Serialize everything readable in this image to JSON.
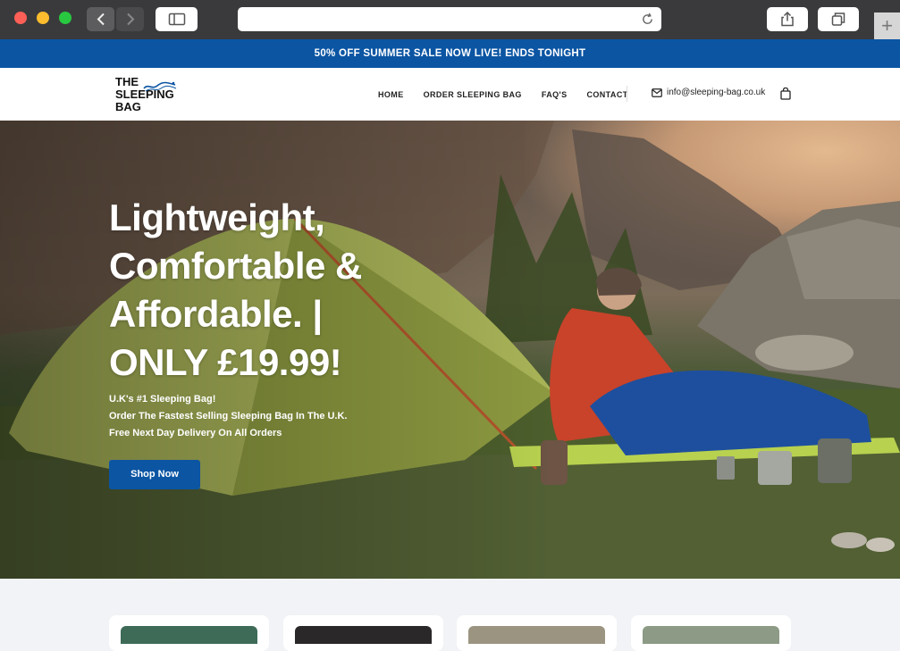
{
  "browser": {
    "back_icon": "chevron-left-icon",
    "forward_icon": "chevron-right-icon",
    "sidebar_icon": "sidebar-icon",
    "reload_icon": "reload-icon",
    "share_icon": "share-icon",
    "tabs_icon": "tabs-icon",
    "new_tab_icon": "plus-icon"
  },
  "announcement": {
    "text": "50% OFF SUMMER SALE NOW LIVE! ENDS TONIGHT"
  },
  "header": {
    "logo_text": "THE\nSLEEPING\nBAG",
    "nav": [
      "HOME",
      "ORDER SLEEPING BAG",
      "FAQ'S",
      "CONTACT"
    ],
    "email": "info@sleeping-bag.co.uk",
    "email_icon": "mail-icon",
    "cart_icon": "shopping-bag-icon"
  },
  "hero": {
    "title": "Lightweight, Comfortable & Affordable. | ONLY £19.99!",
    "lines": [
      "U.K's #1 Sleeping Bag!",
      "Order The Fastest Selling Sleeping Bag In The U.K.",
      "Free Next Day Delivery On All Orders"
    ],
    "cta_label": "Shop Now"
  },
  "colors": {
    "brand_blue": "#0b55a3",
    "header_bg": "#ffffff"
  }
}
